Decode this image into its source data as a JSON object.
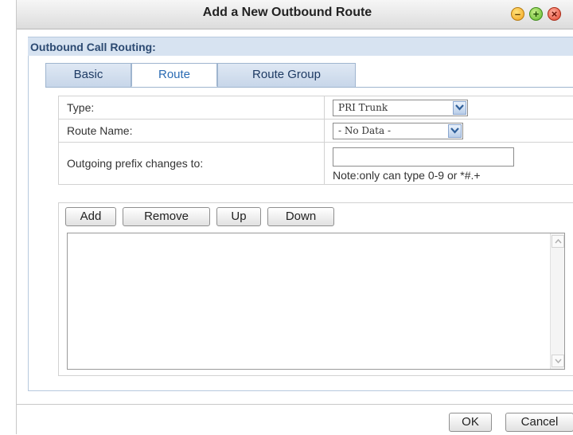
{
  "window": {
    "title": "Add a New Outbound Route",
    "controls": [
      "minimize-icon",
      "maximize-icon",
      "close-icon"
    ]
  },
  "section": {
    "title": "Outbound Call Routing:"
  },
  "tabs": [
    {
      "label": "Basic",
      "active": false
    },
    {
      "label": "Route",
      "active": true
    },
    {
      "label": "Route Group",
      "active": false
    }
  ],
  "form": {
    "type_label": "Type:",
    "type_value": "PRI Trunk",
    "route_name_label": "Route Name:",
    "route_name_value": "- No Data -",
    "prefix_label": "Outgoing prefix changes to:",
    "prefix_value": "",
    "prefix_note": "Note:only can type 0-9 or *#.+"
  },
  "list_toolbar": {
    "add": "Add",
    "remove": "Remove",
    "up": "Up",
    "down": "Down"
  },
  "list_items": [],
  "footer": {
    "ok": "OK",
    "cancel": "Cancel"
  },
  "colors": {
    "tab_active_text": "#2a6bb3",
    "section_header_bg": "#d7e3f1",
    "section_header_text": "#2c4a72"
  }
}
